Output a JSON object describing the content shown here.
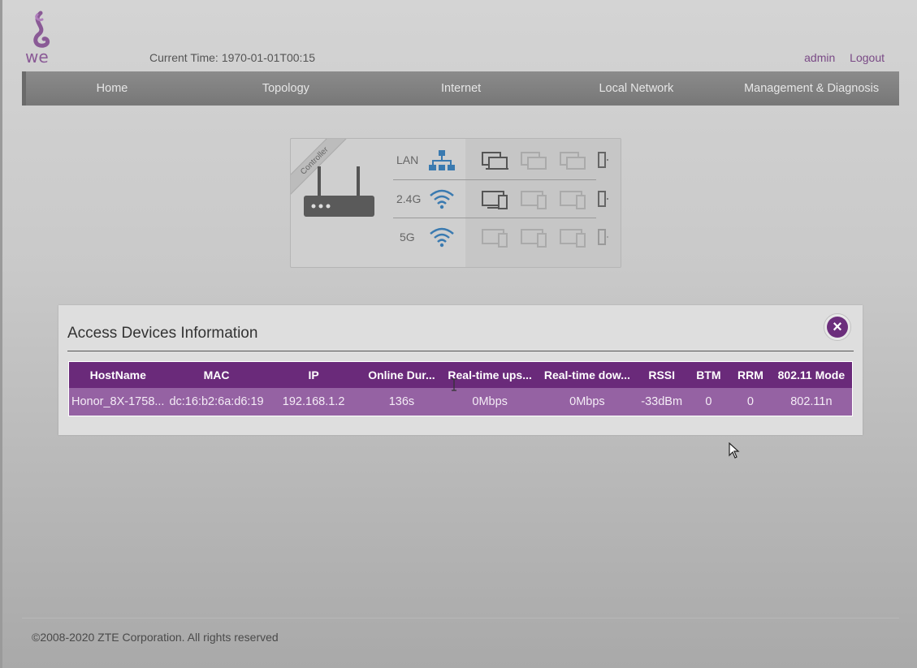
{
  "brand": {
    "logo_text": "we",
    "accent": "#6a2a7a",
    "logo_color": "#8a5a96"
  },
  "header": {
    "current_time_label": "Current Time:",
    "current_time_value": "1970-01-01T00:15",
    "user": "admin",
    "logout": "Logout"
  },
  "nav": {
    "items": [
      {
        "label": "Home"
      },
      {
        "label": "Topology"
      },
      {
        "label": "Internet"
      },
      {
        "label": "Local Network"
      },
      {
        "label": "Management & Diagnosis"
      }
    ]
  },
  "topology": {
    "ribbon": "Controller",
    "rows": [
      {
        "label": "LAN",
        "icon": "network-icon"
      },
      {
        "label": "2.4G",
        "icon": "wifi-icon"
      },
      {
        "label": "5G",
        "icon": "wifi-icon"
      }
    ]
  },
  "modal": {
    "title": "Access Devices Information",
    "close_icon": "close-icon",
    "columns": [
      "HostName",
      "MAC",
      "IP",
      "Online Duration",
      "Real-time upstream",
      "Real-time downstream",
      "RSSI",
      "BTM",
      "RRM",
      "802.11 Mode"
    ],
    "columns_display": [
      "HostName",
      "MAC",
      "IP",
      "Online Dur...",
      "Real-time ups...",
      "Real-time dow...",
      "RSSI",
      "BTM",
      "RRM",
      "802.11 Mode"
    ],
    "rows": [
      [
        "Honor_8X-1758...",
        "dc:16:b2:6a:d6:19",
        "192.168.1.2",
        "136s",
        "0Mbps",
        "0Mbps",
        "-33dBm",
        "0",
        "0",
        "802.11n"
      ]
    ]
  },
  "footer": {
    "copyright": "©2008-2020 ZTE Corporation. All rights reserved"
  }
}
